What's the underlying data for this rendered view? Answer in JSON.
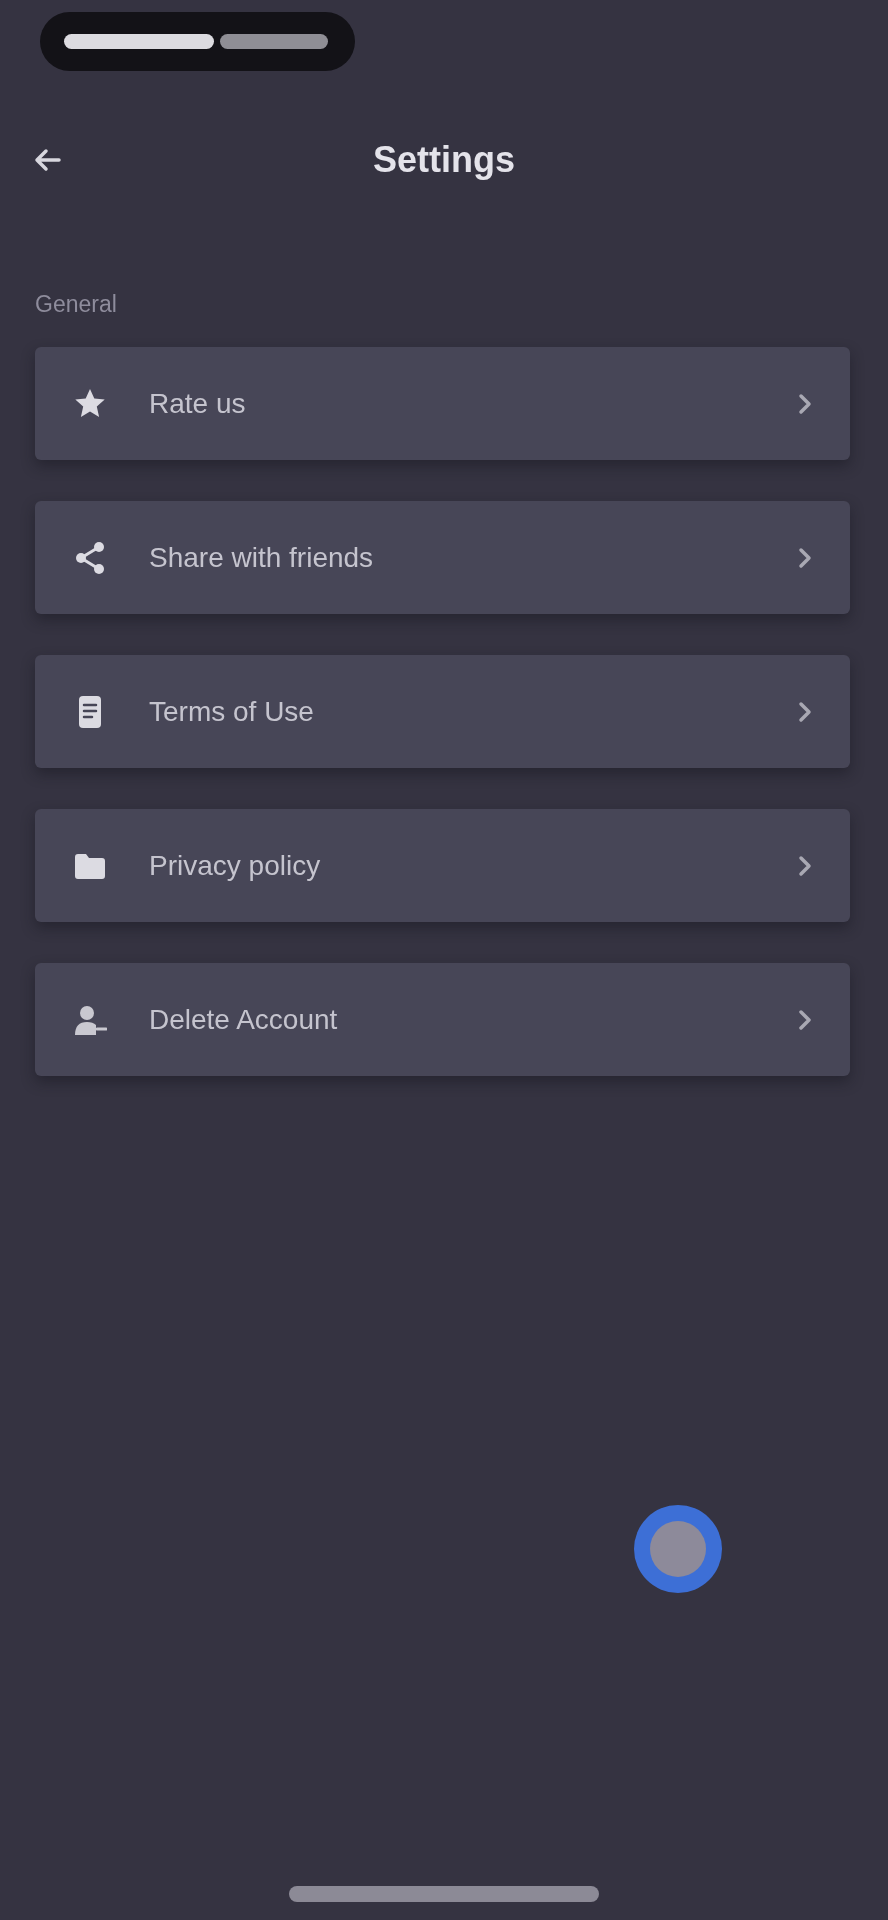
{
  "header": {
    "title": "Settings"
  },
  "sections": [
    {
      "title": "General",
      "items": [
        {
          "label": "Rate us",
          "kind": "rate"
        },
        {
          "label": "Share with friends",
          "kind": "share"
        },
        {
          "label": "Terms of Use",
          "kind": "terms"
        },
        {
          "label": "Privacy policy",
          "kind": "privacy"
        },
        {
          "label": "Delete Account",
          "kind": "delete"
        }
      ]
    }
  ]
}
